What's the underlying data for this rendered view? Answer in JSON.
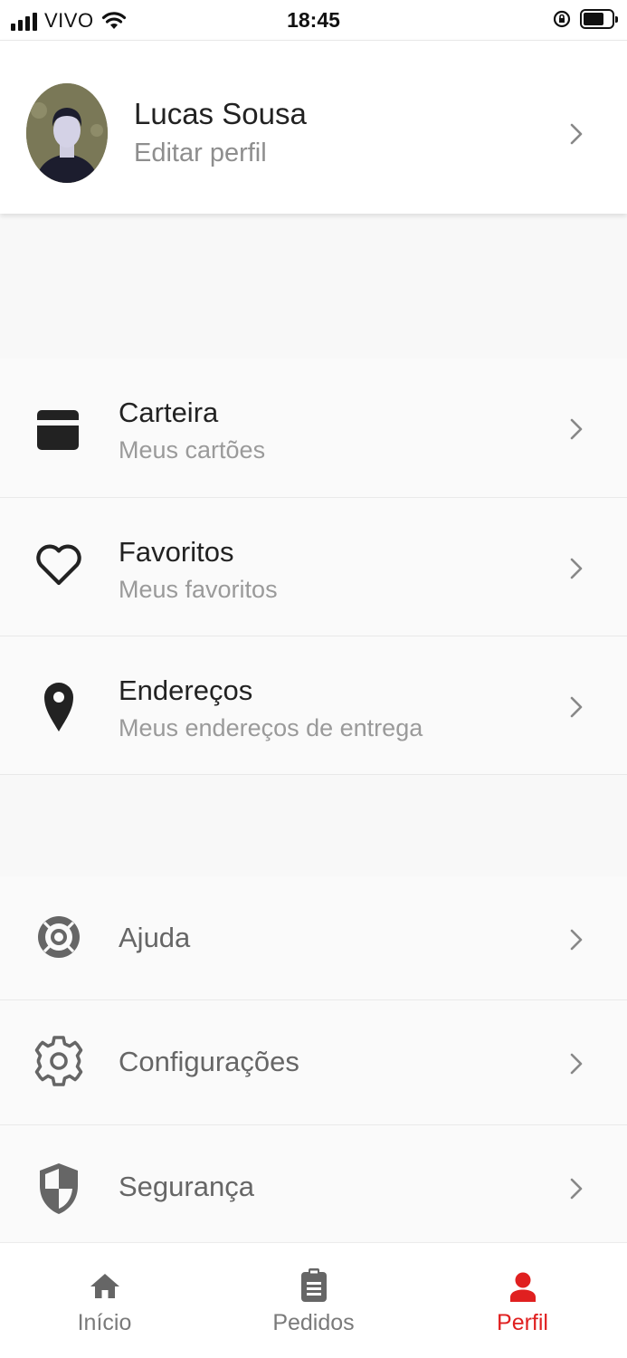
{
  "status_bar": {
    "carrier": "VIVO",
    "time": "18:45",
    "battery_level": 0.72
  },
  "profile": {
    "name": "Lucas Sousa",
    "subtitle": "Editar perfil"
  },
  "menu_primary": [
    {
      "title": "Carteira",
      "subtitle": "Meus cartões",
      "icon": "wallet-card-icon"
    },
    {
      "title": "Favoritos",
      "subtitle": "Meus favoritos",
      "icon": "heart-icon"
    },
    {
      "title": "Endereços",
      "subtitle": "Meus endereços de entrega",
      "icon": "location-pin-icon"
    }
  ],
  "menu_secondary": [
    {
      "label": "Ajuda",
      "icon": "lifebuoy-icon"
    },
    {
      "label": "Configurações",
      "icon": "gear-icon"
    },
    {
      "label": "Segurança",
      "icon": "shield-icon"
    }
  ],
  "bottom_nav": {
    "items": [
      {
        "label": "Início",
        "icon": "home-icon",
        "active": false
      },
      {
        "label": "Pedidos",
        "icon": "clipboard-icon",
        "active": false
      },
      {
        "label": "Perfil",
        "icon": "person-icon",
        "active": true
      }
    ]
  },
  "colors": {
    "accent": "#e02020",
    "text_primary": "#222222",
    "text_secondary": "#9a9a9a",
    "icon_dark": "#333333",
    "icon_gray": "#666666"
  }
}
